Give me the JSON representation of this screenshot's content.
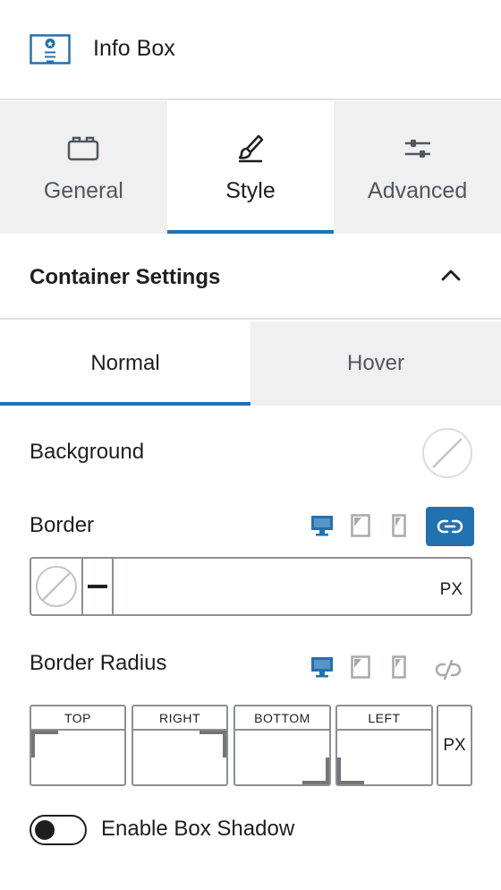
{
  "header": {
    "title": "Info Box",
    "icon": "info-box-block-icon",
    "accent": "#2271b1"
  },
  "tabs": [
    {
      "label": "General",
      "icon": "folder-icon",
      "active": false
    },
    {
      "label": "Style",
      "icon": "paintbrush-icon",
      "active": true
    },
    {
      "label": "Advanced",
      "icon": "sliders-icon",
      "active": false
    }
  ],
  "section": {
    "title": "Container Settings",
    "icon": "chevron-up-icon",
    "expanded": true
  },
  "state_tabs": [
    {
      "label": "Normal",
      "active": true
    },
    {
      "label": "Hover",
      "active": false
    }
  ],
  "background": {
    "label": "Background",
    "color_value": "none"
  },
  "border": {
    "label": "Border",
    "devices": [
      "desktop-icon",
      "tablet-icon",
      "mobile-icon"
    ],
    "active_device": "desktop",
    "linked": true,
    "link_icon": "link-icon",
    "color_value": "none",
    "style_value": "solid",
    "width_value": "",
    "unit": "PX"
  },
  "border_radius": {
    "label": "Border Radius",
    "devices": [
      "desktop-icon",
      "tablet-icon",
      "mobile-icon"
    ],
    "active_device": "desktop",
    "link_icon": "unlink-icon",
    "fields": [
      {
        "label": "TOP",
        "value": ""
      },
      {
        "label": "RIGHT",
        "value": ""
      },
      {
        "label": "BOTTOM",
        "value": ""
      },
      {
        "label": "LEFT",
        "value": ""
      }
    ],
    "unit": "PX"
  },
  "box_shadow": {
    "label": "Enable Box Shadow",
    "enabled": false
  },
  "colors": {
    "accent": "#2271b1",
    "tab_bg": "#f0f0f1",
    "border": "#8c8f94",
    "text": "#1e1e1e",
    "muted": "#50575e"
  }
}
